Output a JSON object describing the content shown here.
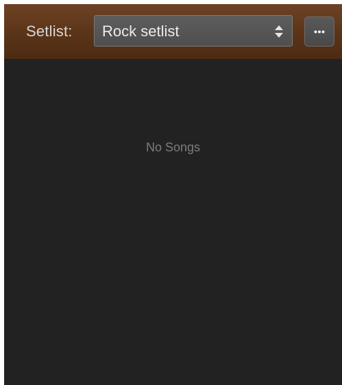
{
  "header": {
    "label": "Setlist:",
    "select": {
      "value": "Rock setlist",
      "icon": "updown-chevrons-icon"
    },
    "more_button": {
      "icon": "ellipsis-icon"
    }
  },
  "song_list": {
    "empty_text": "No Songs"
  },
  "colors": {
    "header_background": "#5a3418",
    "panel_background": "#222222",
    "label_text": "#d8d8d8",
    "select_background": "#555555",
    "empty_text": "#7c7c7c"
  }
}
